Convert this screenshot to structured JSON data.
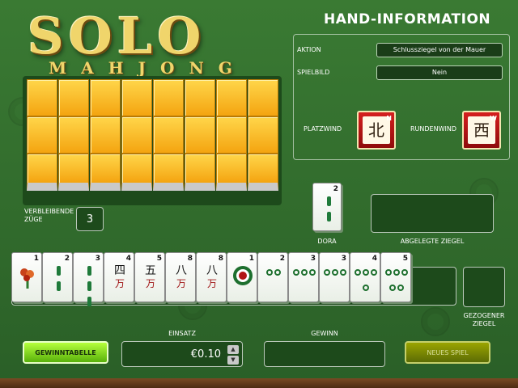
{
  "logo": {
    "main": "SOLO",
    "sub": "MAHJONG"
  },
  "info": {
    "title": "HAND-INFORMATION",
    "aktion_label": "AKTION",
    "aktion_value": "Schlussziegel von der Mauer",
    "spielbild_label": "SPIELBILD",
    "spielbild_value": "Nein",
    "platzwind_label": "PLATZWIND",
    "platzwind_char": "北",
    "platzwind_sup": "N",
    "rundenwind_label": "RUNDENWIND",
    "rundenwind_char": "西",
    "rundenwind_sup": "W"
  },
  "left": {
    "remaining_label_line1": "VERBLEIBENDE",
    "remaining_label_line2": "ZÜGE",
    "remaining_value": "3"
  },
  "dora": {
    "label": "DORA",
    "num": "2"
  },
  "discard": {
    "label": "ABGELEGTE ZIEGEL"
  },
  "drawn": {
    "label_line1": "GEZOGENER",
    "label_line2": "ZIEGEL"
  },
  "hand": [
    {
      "num": "1",
      "kind": "flower"
    },
    {
      "num": "2",
      "kind": "bamboo",
      "count": 2
    },
    {
      "num": "3",
      "kind": "bamboo",
      "count": 3
    },
    {
      "num": "4",
      "kind": "char",
      "top": "四",
      "bottom": "万"
    },
    {
      "num": "5",
      "kind": "char",
      "top": "五",
      "bottom": "万"
    },
    {
      "num": "8",
      "kind": "char",
      "top": "八",
      "bottom": "万"
    },
    {
      "num": "8",
      "kind": "char",
      "top": "八",
      "bottom": "万"
    },
    {
      "num": "1",
      "kind": "circle1"
    },
    {
      "num": "2",
      "kind": "dots",
      "count": 2
    },
    {
      "num": "3",
      "kind": "dots",
      "count": 3
    },
    {
      "num": "3",
      "kind": "dots",
      "count": 3
    },
    {
      "num": "4",
      "kind": "dots",
      "count": 4
    },
    {
      "num": "5",
      "kind": "dots",
      "count": 5
    }
  ],
  "bottom": {
    "btn_gewinntabelle": "GEWINNTABELLE",
    "einsatz_label": "EINSATZ",
    "einsatz_value": "€0.10",
    "gewinn_label": "GEWINN",
    "btn_neues_spiel": "NEUES SPIEL"
  },
  "colors": {
    "felt": "#2f6a2a",
    "wall_tile": "#f4a410",
    "wind_tile": "#c61818",
    "accent_button": "#7fe020"
  }
}
